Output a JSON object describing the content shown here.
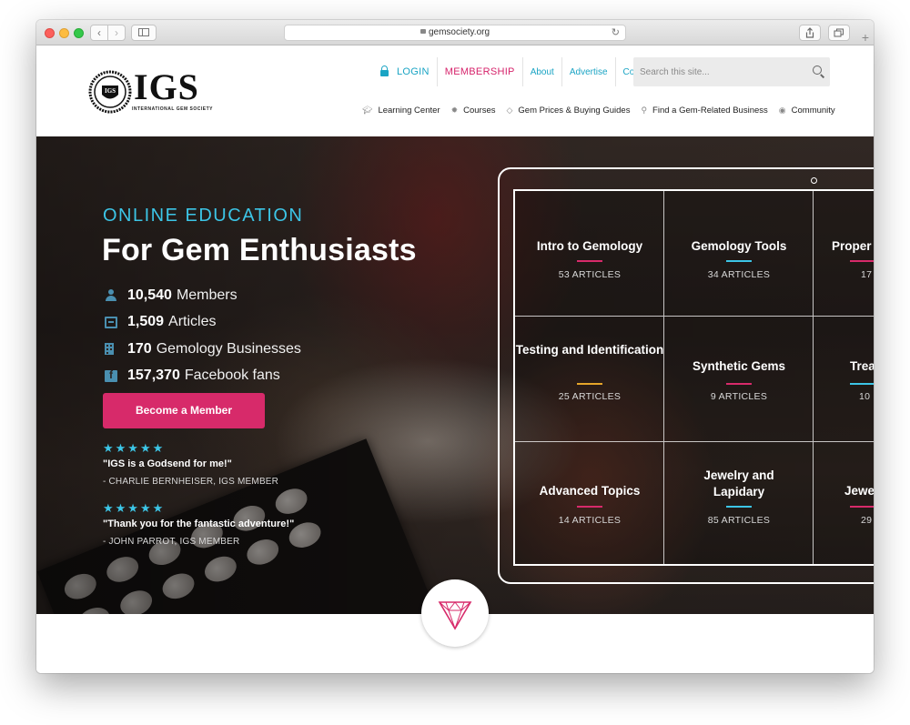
{
  "browser": {
    "url": "gemsociety.org",
    "back_icon": "‹",
    "forward_icon": "›",
    "reload_icon": "↻",
    "new_tab_icon": "+"
  },
  "site": {
    "logo_text": "IGS",
    "logo_subtitle": "INTERNATIONAL GEM SOCIETY",
    "logo_year": "1998",
    "top_nav": {
      "login": "LOGIN",
      "membership": "MEMBERSHIP",
      "about": "About",
      "advertise": "Advertise",
      "contact": "Contact"
    },
    "search_placeholder": "Search this site...",
    "main_nav": [
      {
        "label": "Learning Center",
        "icon": "graduation-cap-icon"
      },
      {
        "label": "Courses",
        "icon": "gear-icon"
      },
      {
        "label": "Gem Prices & Buying Guides",
        "icon": "gem-icon"
      },
      {
        "label": "Find a Gem-Related Business",
        "icon": "map-pin-icon"
      },
      {
        "label": "Community",
        "icon": "chat-icon"
      }
    ]
  },
  "hero": {
    "eyebrow": "ONLINE EDUCATION",
    "headline": "For Gem Enthusiasts",
    "stats": [
      {
        "value": "10,540",
        "label": "Members"
      },
      {
        "value": "1,509",
        "label": "Articles"
      },
      {
        "value": "170",
        "label": "Gemology Businesses"
      },
      {
        "value": "157,370",
        "label": "Facebook fans"
      }
    ],
    "cta": "Become a Member",
    "testimonials": [
      {
        "stars": "★★★★★",
        "quote": "\"IGS is a Godsend for me!\"",
        "author": "- CHARLIE BERNHEISER, IGS MEMBER"
      },
      {
        "stars": "★★★★★",
        "quote": "\"Thank you for the fantastic adventure!\"",
        "author": "- JOHN PARROT, IGS MEMBER"
      }
    ]
  },
  "topics": [
    {
      "title": "Intro to Gemology",
      "count": "53 ARTICLES",
      "accent": "#d72a6a"
    },
    {
      "title": "Gemology Tools",
      "count": "34 ARTICLES",
      "accent": "#3cc5e6"
    },
    {
      "title": "Proper",
      "count": "17",
      "accent": "#d72a6a"
    },
    {
      "title": "Testing and Identification",
      "count": "25 ARTICLES",
      "accent": "#e5a52a"
    },
    {
      "title": "Synthetic Gems",
      "count": "9 ARTICLES",
      "accent": "#d72a6a"
    },
    {
      "title": "Trea",
      "count": "10",
      "accent": "#3cc5e6"
    },
    {
      "title": "Advanced Topics",
      "count": "14 ARTICLES",
      "accent": "#d72a6a"
    },
    {
      "title": "Jewelry and Lapidary",
      "count": "85 ARTICLES",
      "accent": "#3cc5e6"
    },
    {
      "title": "Jewe",
      "count": "29",
      "accent": "#d72a6a"
    }
  ],
  "colors": {
    "accent_cyan": "#3cc5e6",
    "accent_pink": "#d72a6a"
  }
}
